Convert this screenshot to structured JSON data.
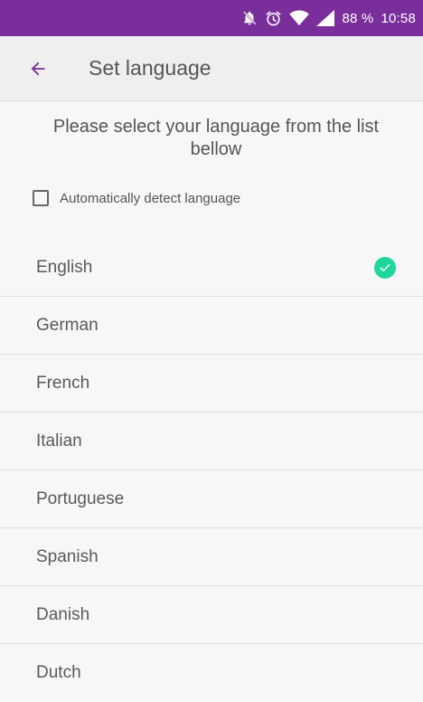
{
  "status_bar": {
    "battery": "88 %",
    "time": "10:58",
    "background": "#7a2e9b",
    "icons": [
      "notifications-off-icon",
      "alarm-icon",
      "wifi-icon",
      "signal-icon"
    ]
  },
  "app_bar": {
    "title": "Set language",
    "back_icon": "arrow-left-icon",
    "accent": "#7a2e9b"
  },
  "prompt": "Please select your language from the list bellow",
  "auto_detect": {
    "label": "Automatically detect language",
    "checked": false
  },
  "languages": [
    {
      "label": "English",
      "selected": true
    },
    {
      "label": "German",
      "selected": false
    },
    {
      "label": "French",
      "selected": false
    },
    {
      "label": "Italian",
      "selected": false
    },
    {
      "label": "Portuguese",
      "selected": false
    },
    {
      "label": "Spanish",
      "selected": false
    },
    {
      "label": "Danish",
      "selected": false
    },
    {
      "label": "Dutch",
      "selected": false
    }
  ],
  "selected_color": "#1fd79b"
}
